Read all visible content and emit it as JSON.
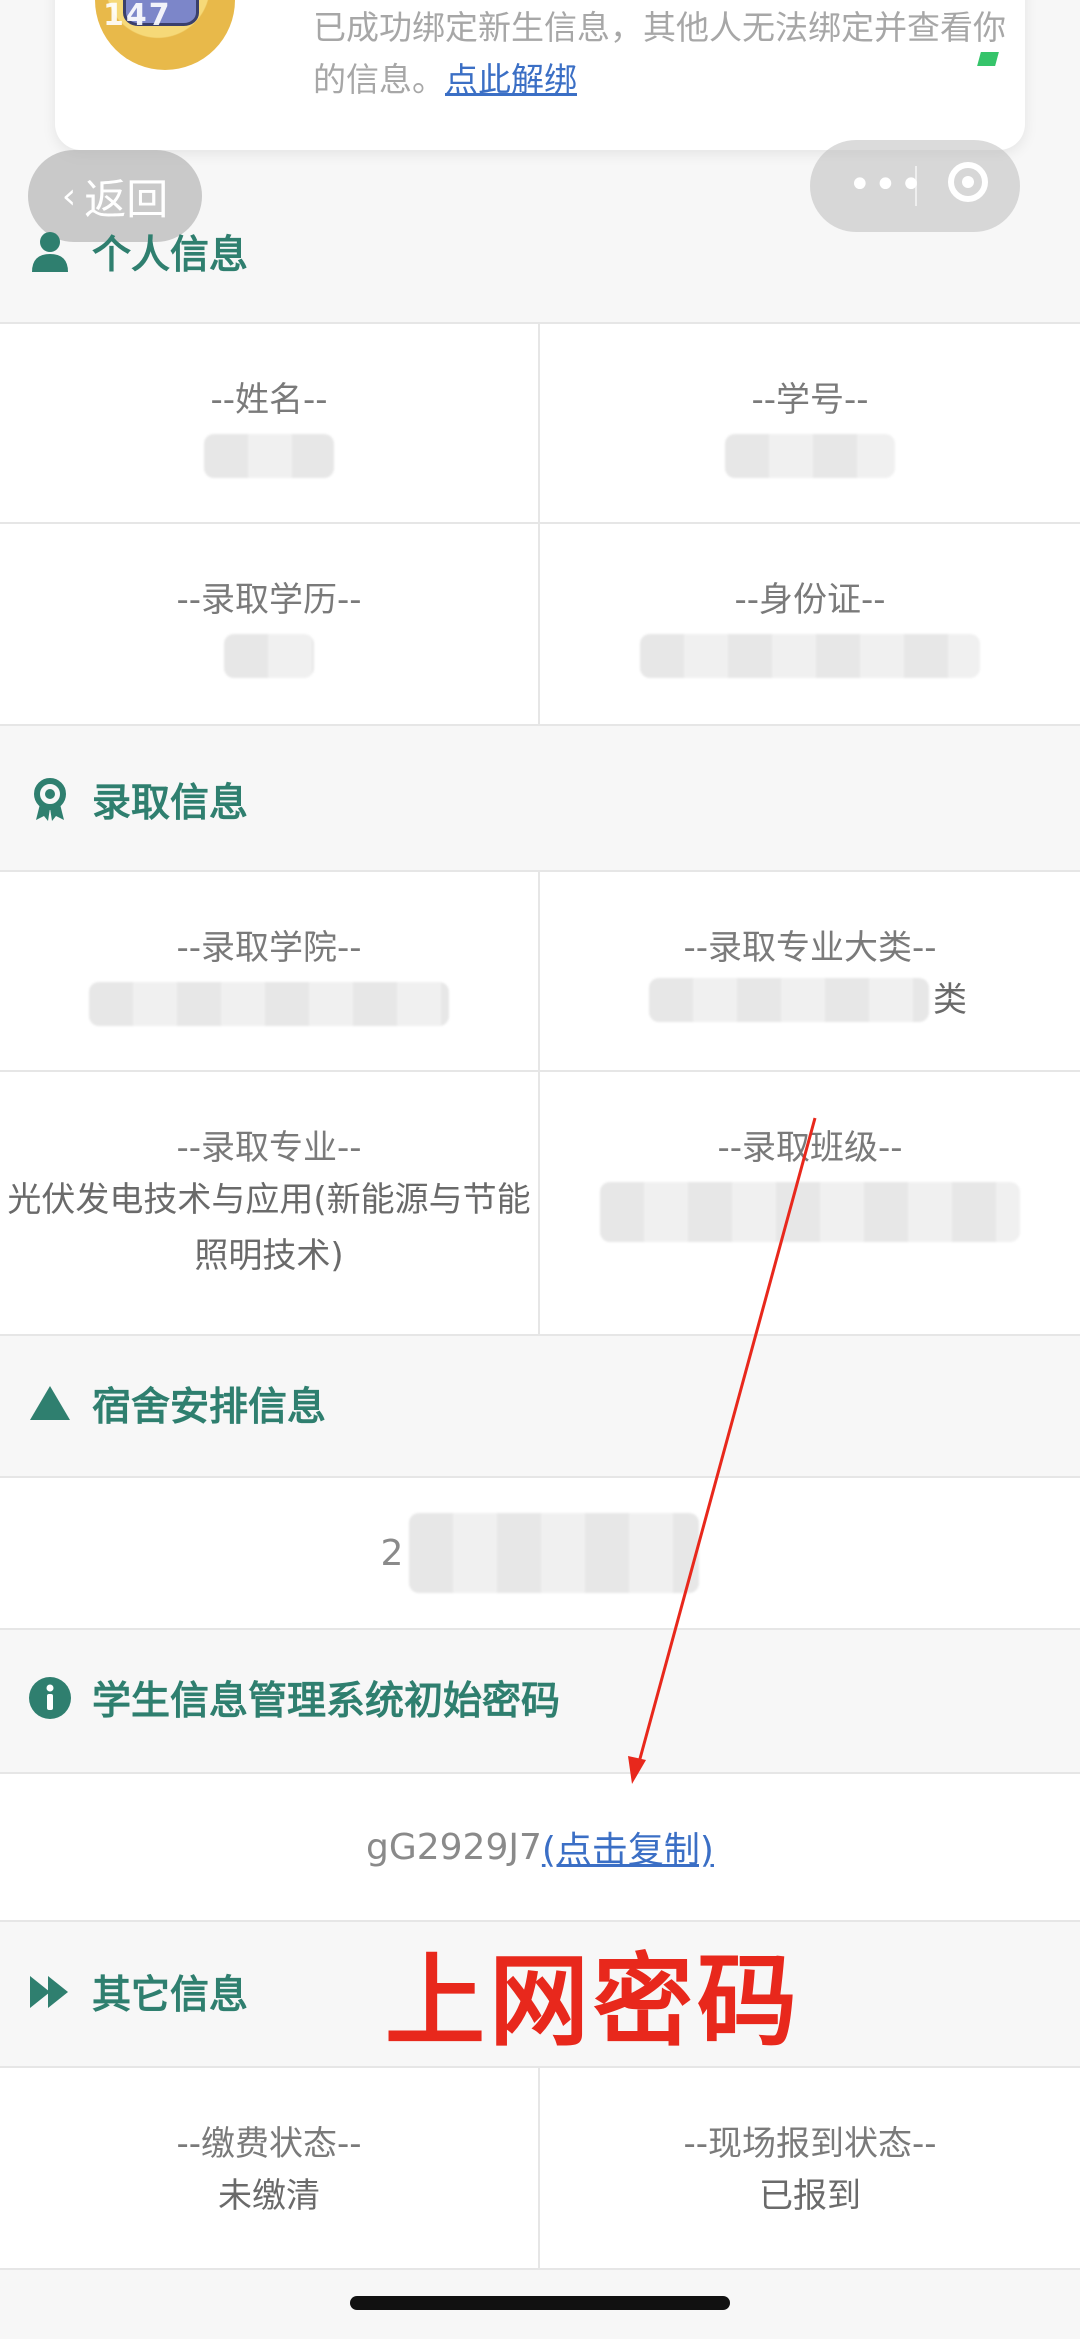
{
  "notice": {
    "avatar_tag": "147",
    "bind_text": "已成功绑定新生信息，其他人无法绑定并查看你的信息。",
    "unbind_link": "点此解绑"
  },
  "nav": {
    "back_label": "返回",
    "menu_dots": "•••"
  },
  "personal": {
    "title": "个人信息",
    "fields": [
      {
        "label": "--姓名--",
        "value": ""
      },
      {
        "label": "--学号--",
        "value": ""
      },
      {
        "label": "--录取学历--",
        "value": ""
      },
      {
        "label": "--身份证--",
        "value": ""
      }
    ]
  },
  "admission": {
    "title": "录取信息",
    "fields": [
      {
        "label": "--录取学院--",
        "value": ""
      },
      {
        "label": "--录取专业大类--",
        "value": "类"
      },
      {
        "label": "--录取专业--",
        "value": "光伏发电技术与应用(新能源与节能照明技术)"
      },
      {
        "label": "--录取班级--",
        "value": ""
      }
    ]
  },
  "dorm": {
    "title": "宿舍安排信息",
    "value": "2"
  },
  "password": {
    "title": "学生信息管理系统初始密码",
    "value": "gG2929J7",
    "copy_label": "(点击复制)"
  },
  "other": {
    "title": "其它信息",
    "fields": [
      {
        "label": "--缴费状态--",
        "value": "未缴清"
      },
      {
        "label": "--现场报到状态--",
        "value": "已报到"
      }
    ]
  },
  "annotation": {
    "text": "上网密码",
    "color": "#e8281c"
  },
  "theme": {
    "accent": "#2f7f6f",
    "link": "#3b6fc5"
  }
}
